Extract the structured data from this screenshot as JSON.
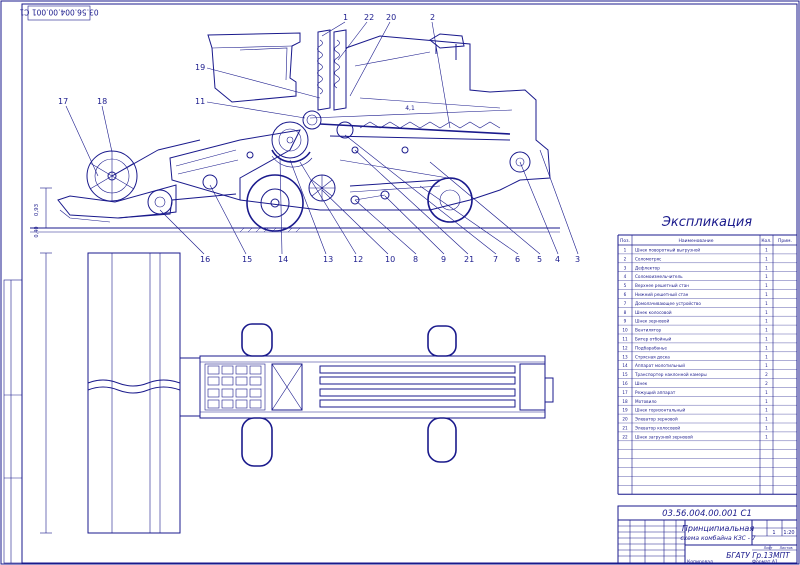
{
  "document_code_rotated": "03.56.004.00.001 С1",
  "callouts_top": [
    "1",
    "22",
    "20",
    "2"
  ],
  "callouts_left": [
    "19",
    "11",
    "17",
    "18"
  ],
  "callouts_bottom": [
    "16",
    "15",
    "14",
    "13",
    "12",
    "10",
    "8",
    "9",
    "21",
    "7",
    "6",
    "5",
    "4",
    "3"
  ],
  "explication": {
    "title": "Экспликация",
    "headers": [
      "Поз.",
      "Наименование",
      "Кол.",
      "Прим."
    ],
    "rows": [
      [
        "1",
        "Шнек поворотный выгрузной",
        "1",
        ""
      ],
      [
        "2",
        "Соломотряс",
        "1",
        ""
      ],
      [
        "3",
        "Дефлектор",
        "1",
        ""
      ],
      [
        "4",
        "Соломоизмельчитель",
        "1",
        ""
      ],
      [
        "5",
        "Верхнее решетный стан",
        "1",
        ""
      ],
      [
        "6",
        "Нижний решетный стан",
        "1",
        ""
      ],
      [
        "7",
        "Домолачивающее устройство",
        "1",
        ""
      ],
      [
        "8",
        "Шнек колосовой",
        "1",
        ""
      ],
      [
        "9",
        "Шнек зерновой",
        "1",
        ""
      ],
      [
        "10",
        "Вентилятор",
        "1",
        ""
      ],
      [
        "11",
        "Битер отбойный",
        "1",
        ""
      ],
      [
        "12",
        "Подбарабанье",
        "1",
        ""
      ],
      [
        "13",
        "Стрясная доска",
        "1",
        ""
      ],
      [
        "14",
        "Аппарат молотильный",
        "1",
        ""
      ],
      [
        "15",
        "Транспортер наклонной камеры",
        "2",
        ""
      ],
      [
        "16",
        "Шнек",
        "2",
        ""
      ],
      [
        "17",
        "Режущий аппарат",
        "1",
        ""
      ],
      [
        "18",
        "Мотовило",
        "1",
        ""
      ],
      [
        "19",
        "Шнек горизонтальный",
        "1",
        ""
      ],
      [
        "20",
        "Элеватор зерновой",
        "1",
        ""
      ],
      [
        "21",
        "Элеватор колосовой",
        "1",
        ""
      ],
      [
        "22",
        "Шнек загрузной зерновой",
        "1",
        ""
      ]
    ]
  },
  "title_block": {
    "doc_number": "03.56.004.00.001 С1",
    "title_line1": "Принципиальная",
    "title_line2": "схема комбайна КЗС - 7",
    "organization": "БГАТУ Гр.13МПТ",
    "sheet_label": "Лист",
    "sheets_label": "Листов",
    "sheet_value": "1",
    "scale_value": "1:20"
  },
  "bottom_notes": [
    "Копировал",
    "Формат А1"
  ],
  "dimension_labels": {
    "length_top": "4,1",
    "height_left": "0,93",
    "height_left2": "0,40"
  }
}
